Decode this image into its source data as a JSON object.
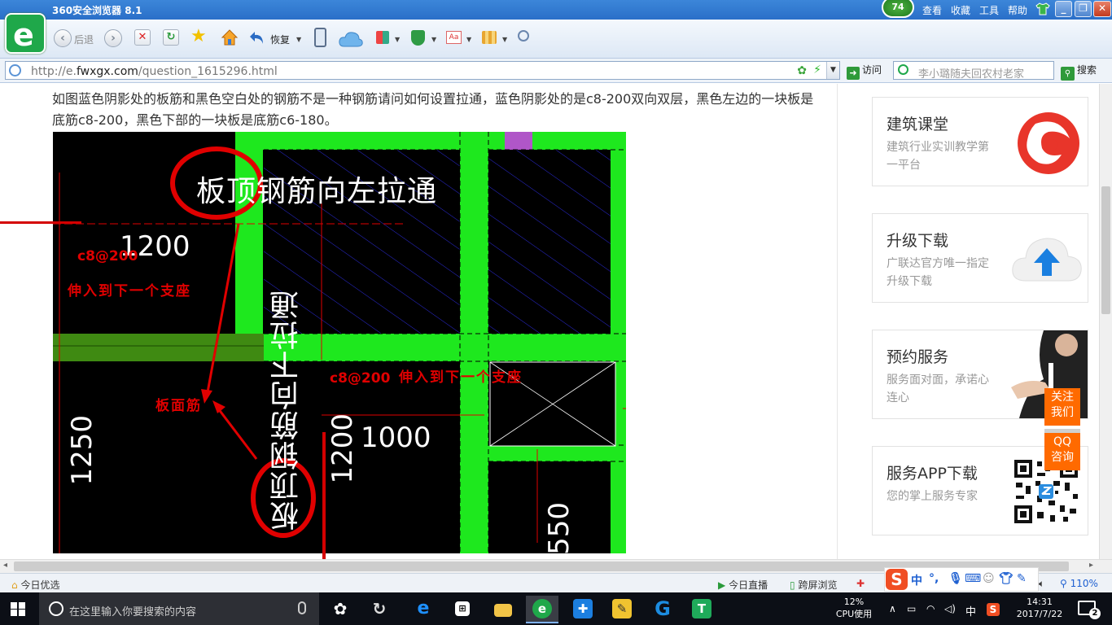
{
  "browser": {
    "title": "360安全浏览器 8.1",
    "badge": "74",
    "menu": [
      "查看",
      "收藏",
      "工具",
      "帮助"
    ],
    "win_buttons": [
      "_",
      "❐",
      "✕"
    ]
  },
  "toolbar": {
    "back_label": "后退",
    "restore_label": "恢复"
  },
  "address": {
    "url_prefix": "http://e.",
    "url_domain": "fwxgx.com",
    "url_path": "/question_1615296.html",
    "go_label": "访问",
    "search_placeholder": "李小璐随夫回农村老家",
    "search_label": "搜索"
  },
  "question": {
    "text": "如图蓝色阴影处的板筋和黑色空白处的钢筋不是一种钢筋请问如何设置拉通，蓝色阴影处的是c8-200双向双层，黑色左边的一块板是底筋c8-200，黑色下部的一块板是底筋c6-180。"
  },
  "cad": {
    "label_top": "板顶钢筋向左拉通",
    "label_vertical": "板顶钢筋向下拉通",
    "dim_1200_h": "1200",
    "dim_1250": "1250",
    "dim_1200_v": "1200",
    "dim_1000": "1000",
    "dim_550": "550",
    "rebar_1": "c8@200",
    "rebar_2": "c8@200",
    "note_1": "伸入到下一个支座",
    "note_2": "伸入到下一个支座",
    "note_3": "板面筋"
  },
  "sidebar": {
    "cards": [
      {
        "title": "建筑课堂",
        "desc": "建筑行业实训教学第一平台"
      },
      {
        "title": "升级下载",
        "desc": "广联达官方唯一指定升级下载"
      },
      {
        "title": "预约服务",
        "desc": "服务面对面，承诺心连心"
      },
      {
        "title": "服务APP下载",
        "desc": "您的掌上服务专家"
      }
    ],
    "follow_label": "关注我们",
    "qq_label": "QQ咨询"
  },
  "status": {
    "left": "今日优选",
    "live": "今日直播",
    "screen": "跨屏浏览",
    "zoom": "110%"
  },
  "ime": {
    "chars": [
      "中",
      "°,"
    ]
  },
  "taskbar": {
    "search_placeholder": "在这里输入你要搜索的内容",
    "cpu_value": "12%",
    "cpu_label": "CPU使用",
    "ime_lang": "中",
    "time": "14:31",
    "date": "2017/7/22",
    "notifications": "2"
  }
}
